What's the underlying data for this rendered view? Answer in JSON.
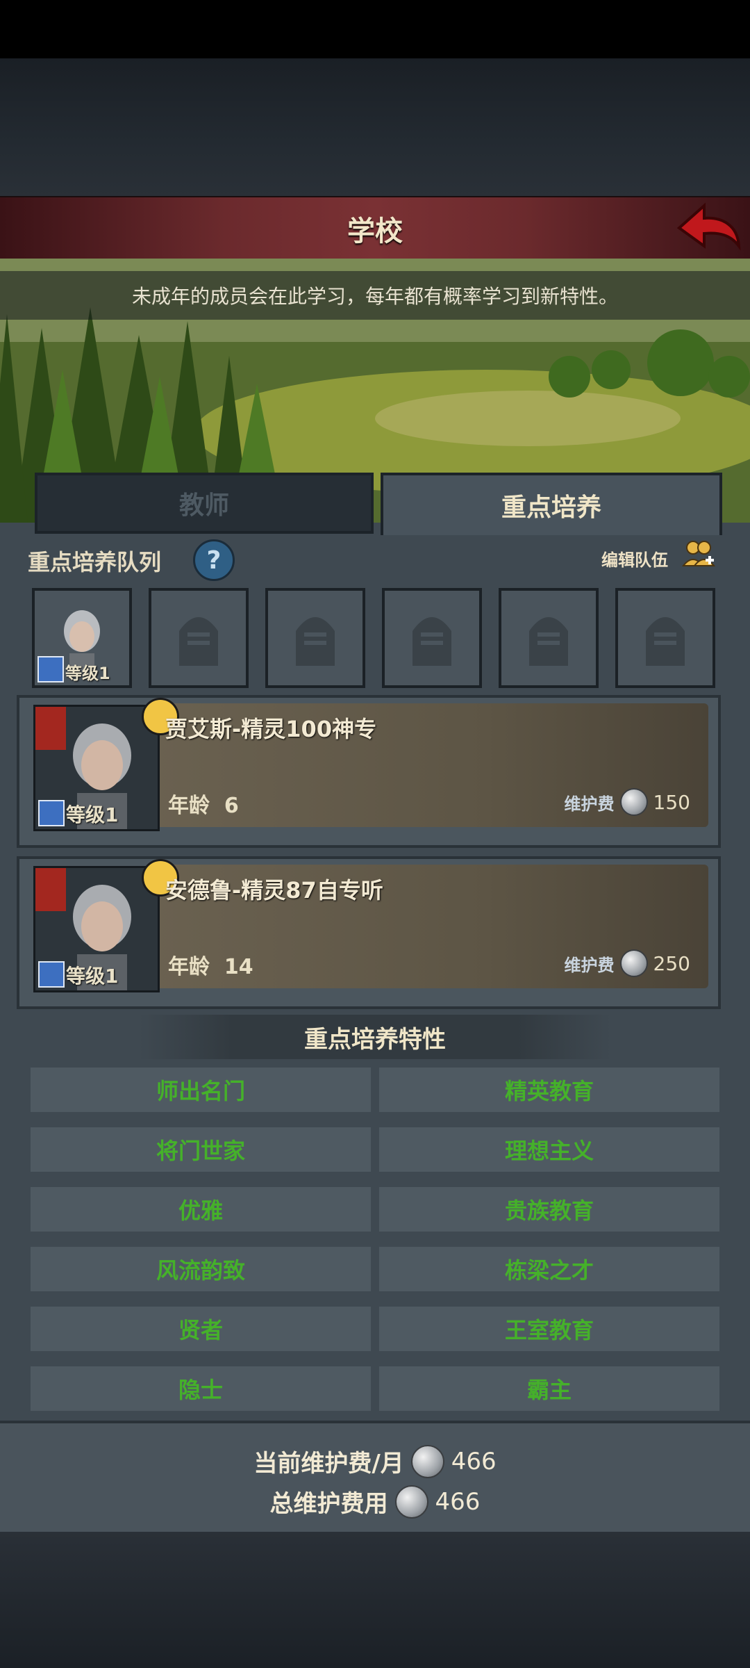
{
  "header": {
    "title": "学校"
  },
  "banner": {
    "description": "未成年的成员会在此学习，每年都有概率学习到新特性。"
  },
  "tabs": [
    {
      "label": "教师",
      "active": false
    },
    {
      "label": "重点培养",
      "active": true
    }
  ],
  "queue": {
    "title": "重点培养队列",
    "help_icon": "?",
    "edit_label": "编辑队伍",
    "slots": [
      {
        "occupied": true,
        "level_label": "等级1"
      },
      {
        "occupied": false
      },
      {
        "occupied": false
      },
      {
        "occupied": false
      },
      {
        "occupied": false
      },
      {
        "occupied": false
      }
    ]
  },
  "members": [
    {
      "name": "贾艾斯-精灵100神专",
      "age_label": "年龄",
      "age": "6",
      "level_label": "等级1",
      "fee_label": "维护费",
      "fee": "150"
    },
    {
      "name": "安德鲁-精灵87自专听",
      "age_label": "年龄",
      "age": "14",
      "level_label": "等级1",
      "fee_label": "维护费",
      "fee": "250"
    }
  ],
  "traits": {
    "title": "重点培养特性",
    "left": [
      "师出名门",
      "将门世家",
      "优雅",
      "风流韵致",
      "贤者",
      "隐士"
    ],
    "right": [
      "精英教育",
      "理想主义",
      "贵族教育",
      "栋梁之才",
      "王室教育",
      "霸主"
    ],
    "color": "#45b12a"
  },
  "footer": {
    "monthly_label": "当前维护费/月",
    "monthly_value": "466",
    "total_label": "总维护费用",
    "total_value": "466"
  }
}
